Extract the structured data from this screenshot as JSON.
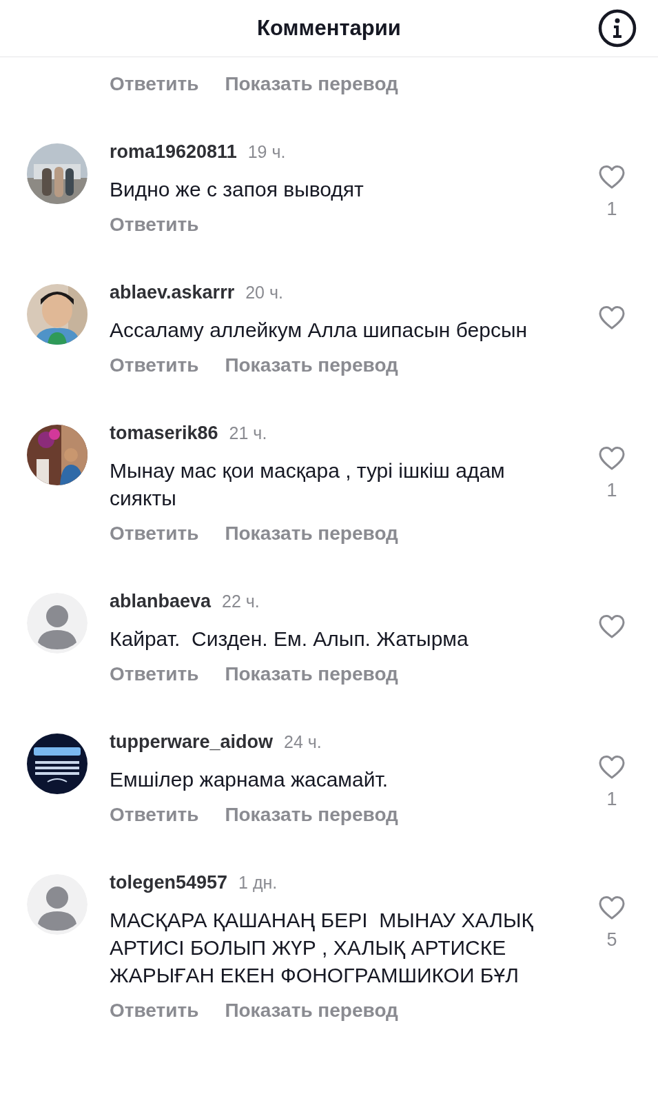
{
  "header": {
    "title": "Комментарии"
  },
  "partial_comment": {
    "actions": [
      "Ответить",
      "Показать перевод"
    ]
  },
  "comments": [
    {
      "username": "roma19620811",
      "time": "19 ч.",
      "text": "Видно же с запоя выводят",
      "likes": "1",
      "avatar": {
        "kind": "picture"
      },
      "actions": [
        "Ответить"
      ]
    },
    {
      "username": "ablaev.askarrr",
      "time": "20 ч.",
      "text": "Ассаламу аллейкум Алла шипасын берсын",
      "avatar": {
        "kind": "picture"
      },
      "actions": [
        "Ответить",
        "Показать перевод"
      ]
    },
    {
      "username": "tomaserik86",
      "time": "21 ч.",
      "text": "Мынау мас қои масқара , турі ішкіш адам сиякты",
      "likes": "1",
      "avatar": {
        "kind": "picture"
      },
      "actions": [
        "Ответить",
        "Показать перевод"
      ]
    },
    {
      "username": "ablanbaeva",
      "time": "22 ч.",
      "text": "Кайрат.  Сизден. Ем. Алып. Жатырма",
      "avatar": {
        "kind": "default"
      },
      "actions": [
        "Ответить",
        "Показать перевод"
      ]
    },
    {
      "username": "tupperware_aidow",
      "time": "24 ч.",
      "text": "Емшілер жарнама жасамайт.",
      "likes": "1",
      "avatar": {
        "kind": "picture"
      },
      "actions": [
        "Ответить",
        "Показать перевод"
      ]
    },
    {
      "username": "tolegen54957",
      "time": "1 дн.",
      "text": "МАСҚАРА ҚАШАНАҢ БЕРІ  МЫНАУ ХАЛЫҚ АРТИСІ БОЛЫП ЖҮР , ХАЛЫҚ АРТИСКЕ ЖАРЫҒАН ЕКЕН ФОНОГРАМШИКОИ БҰЛ",
      "likes": "5",
      "avatar": {
        "kind": "default"
      },
      "actions": [
        "Ответить",
        "Показать перевод"
      ]
    }
  ]
}
